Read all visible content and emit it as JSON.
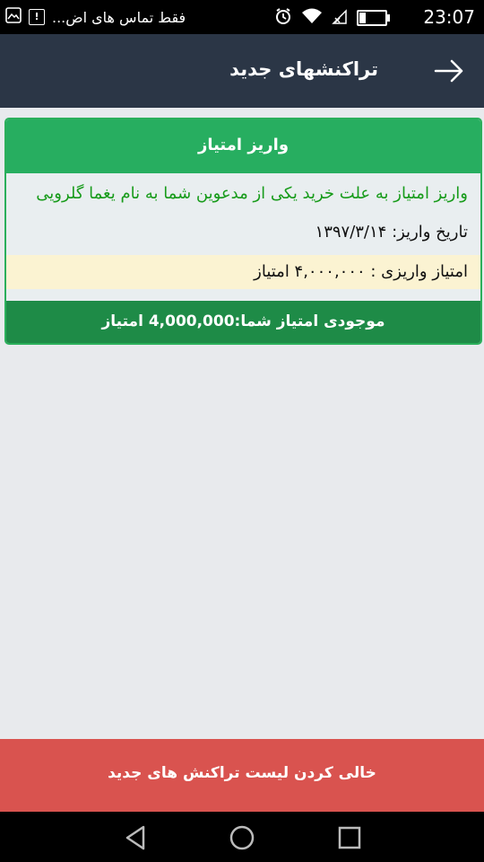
{
  "status_bar": {
    "time": "23:07",
    "notification_text": "فقط تماس های اض...",
    "icons": [
      "alarm-icon",
      "wifi-icon",
      "no-signal-icon",
      "battery-icon",
      "image-icon",
      "alert-icon"
    ]
  },
  "header": {
    "title": "تراکنشهای جدید",
    "back_icon": "arrow-right-icon"
  },
  "transaction": {
    "title": "واریز امتیاز",
    "description": "واریز امتیاز به علت خرید یکی از مدعوین شما به نام یغما گلرویی",
    "date_text": "تاریخ واریز: ۱۳۹۷/۳/۱۴",
    "amount_text": "امتیاز واریزی : ۴,۰۰۰,۰۰۰ امتیاز",
    "balance_text": "موجودی امتیاز شما:4,000,000 امتیاز"
  },
  "actions": {
    "clear_label": "خالی کردن لیست تراکنش های جدید"
  },
  "colors": {
    "appbar": "#2b3646",
    "card_header": "#27ae60",
    "card_footer": "#1e8b47",
    "description_text": "#179b1a",
    "amount_bg": "#fbf3d2",
    "clear_button": "#d9534f"
  }
}
